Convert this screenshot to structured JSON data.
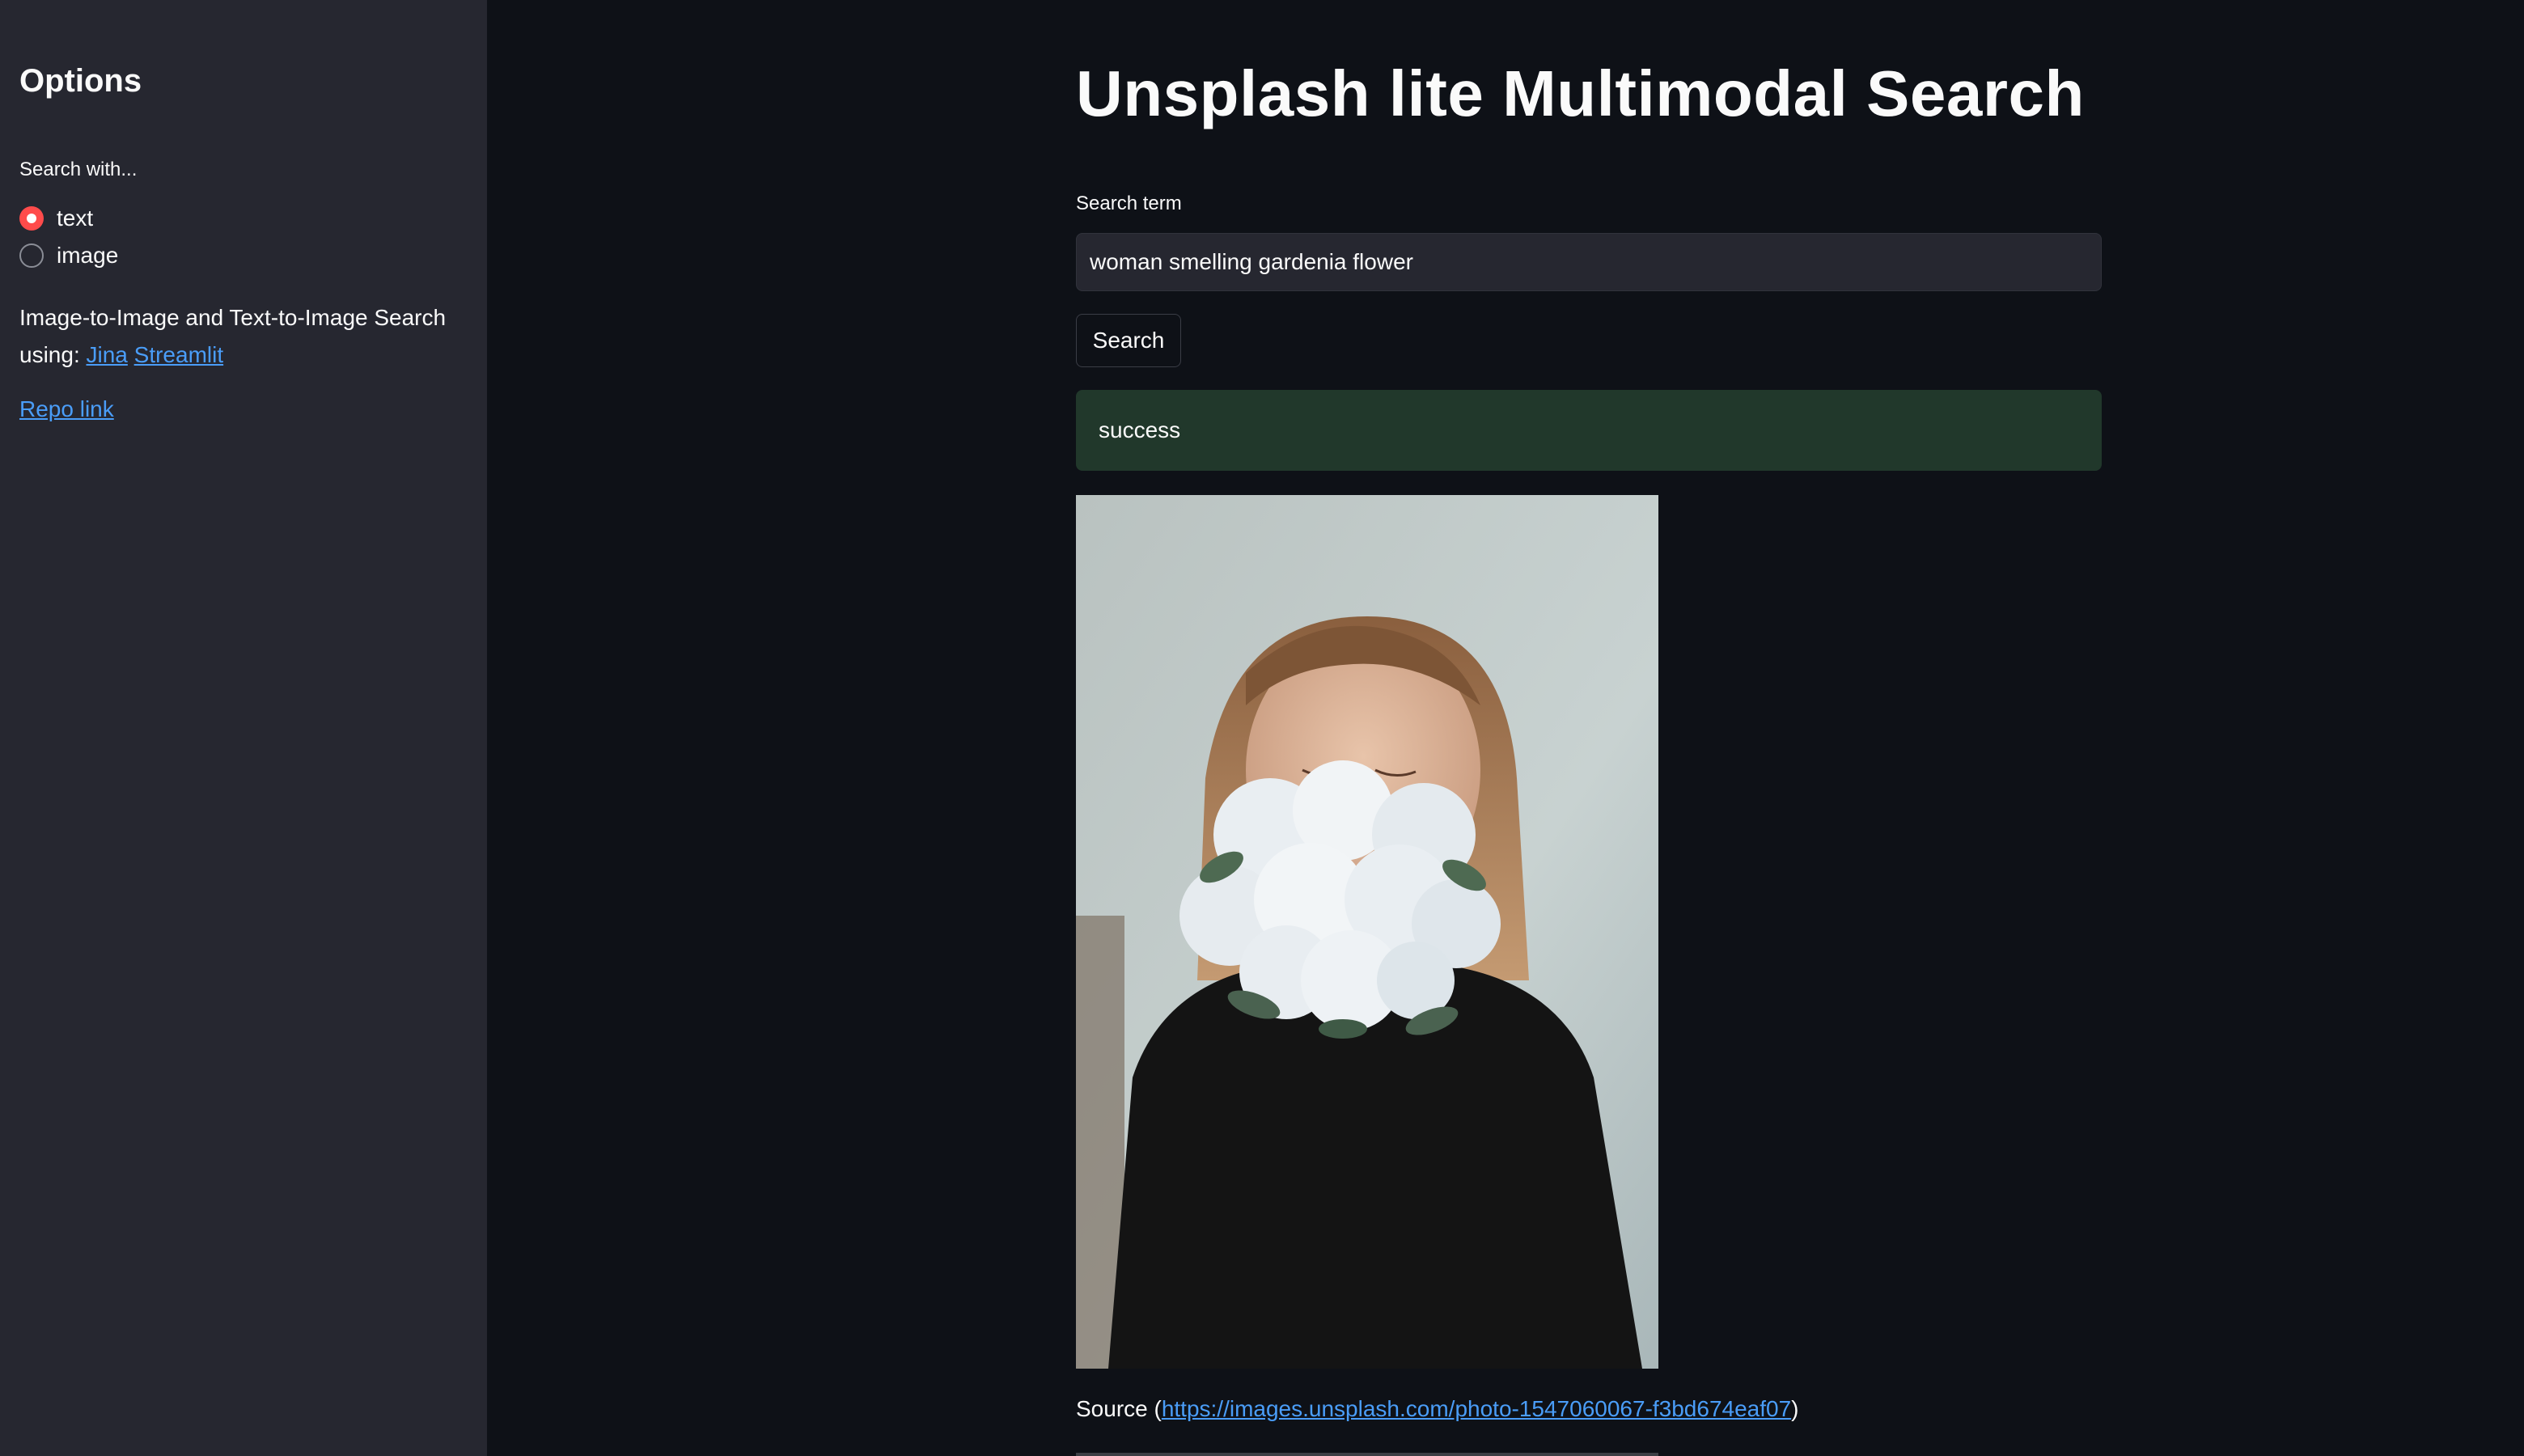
{
  "sidebar": {
    "title": "Options",
    "radio_label": "Search with...",
    "options": [
      {
        "label": "text",
        "selected": true
      },
      {
        "label": "image",
        "selected": false
      }
    ],
    "description_prefix": "Image-to-Image and Text-to-Image Search using:",
    "links": [
      "Jina",
      "Streamlit"
    ],
    "repo_link": "Repo link"
  },
  "main": {
    "title": "Unsplash lite Multimodal Search",
    "search_label": "Search term",
    "search_value": "woman smelling gardenia flower",
    "search_button": "Search",
    "status": "success",
    "result": {
      "source_prefix": "Source (",
      "source_url": "https://images.unsplash.com/photo-1547060067-f3bd674eaf07",
      "source_suffix": ")"
    }
  },
  "colors": {
    "background": "#0e1117",
    "sidebar": "#262730",
    "accent": "#ff4b4b",
    "link": "#4a9df8",
    "success_bg": "#21382b"
  }
}
